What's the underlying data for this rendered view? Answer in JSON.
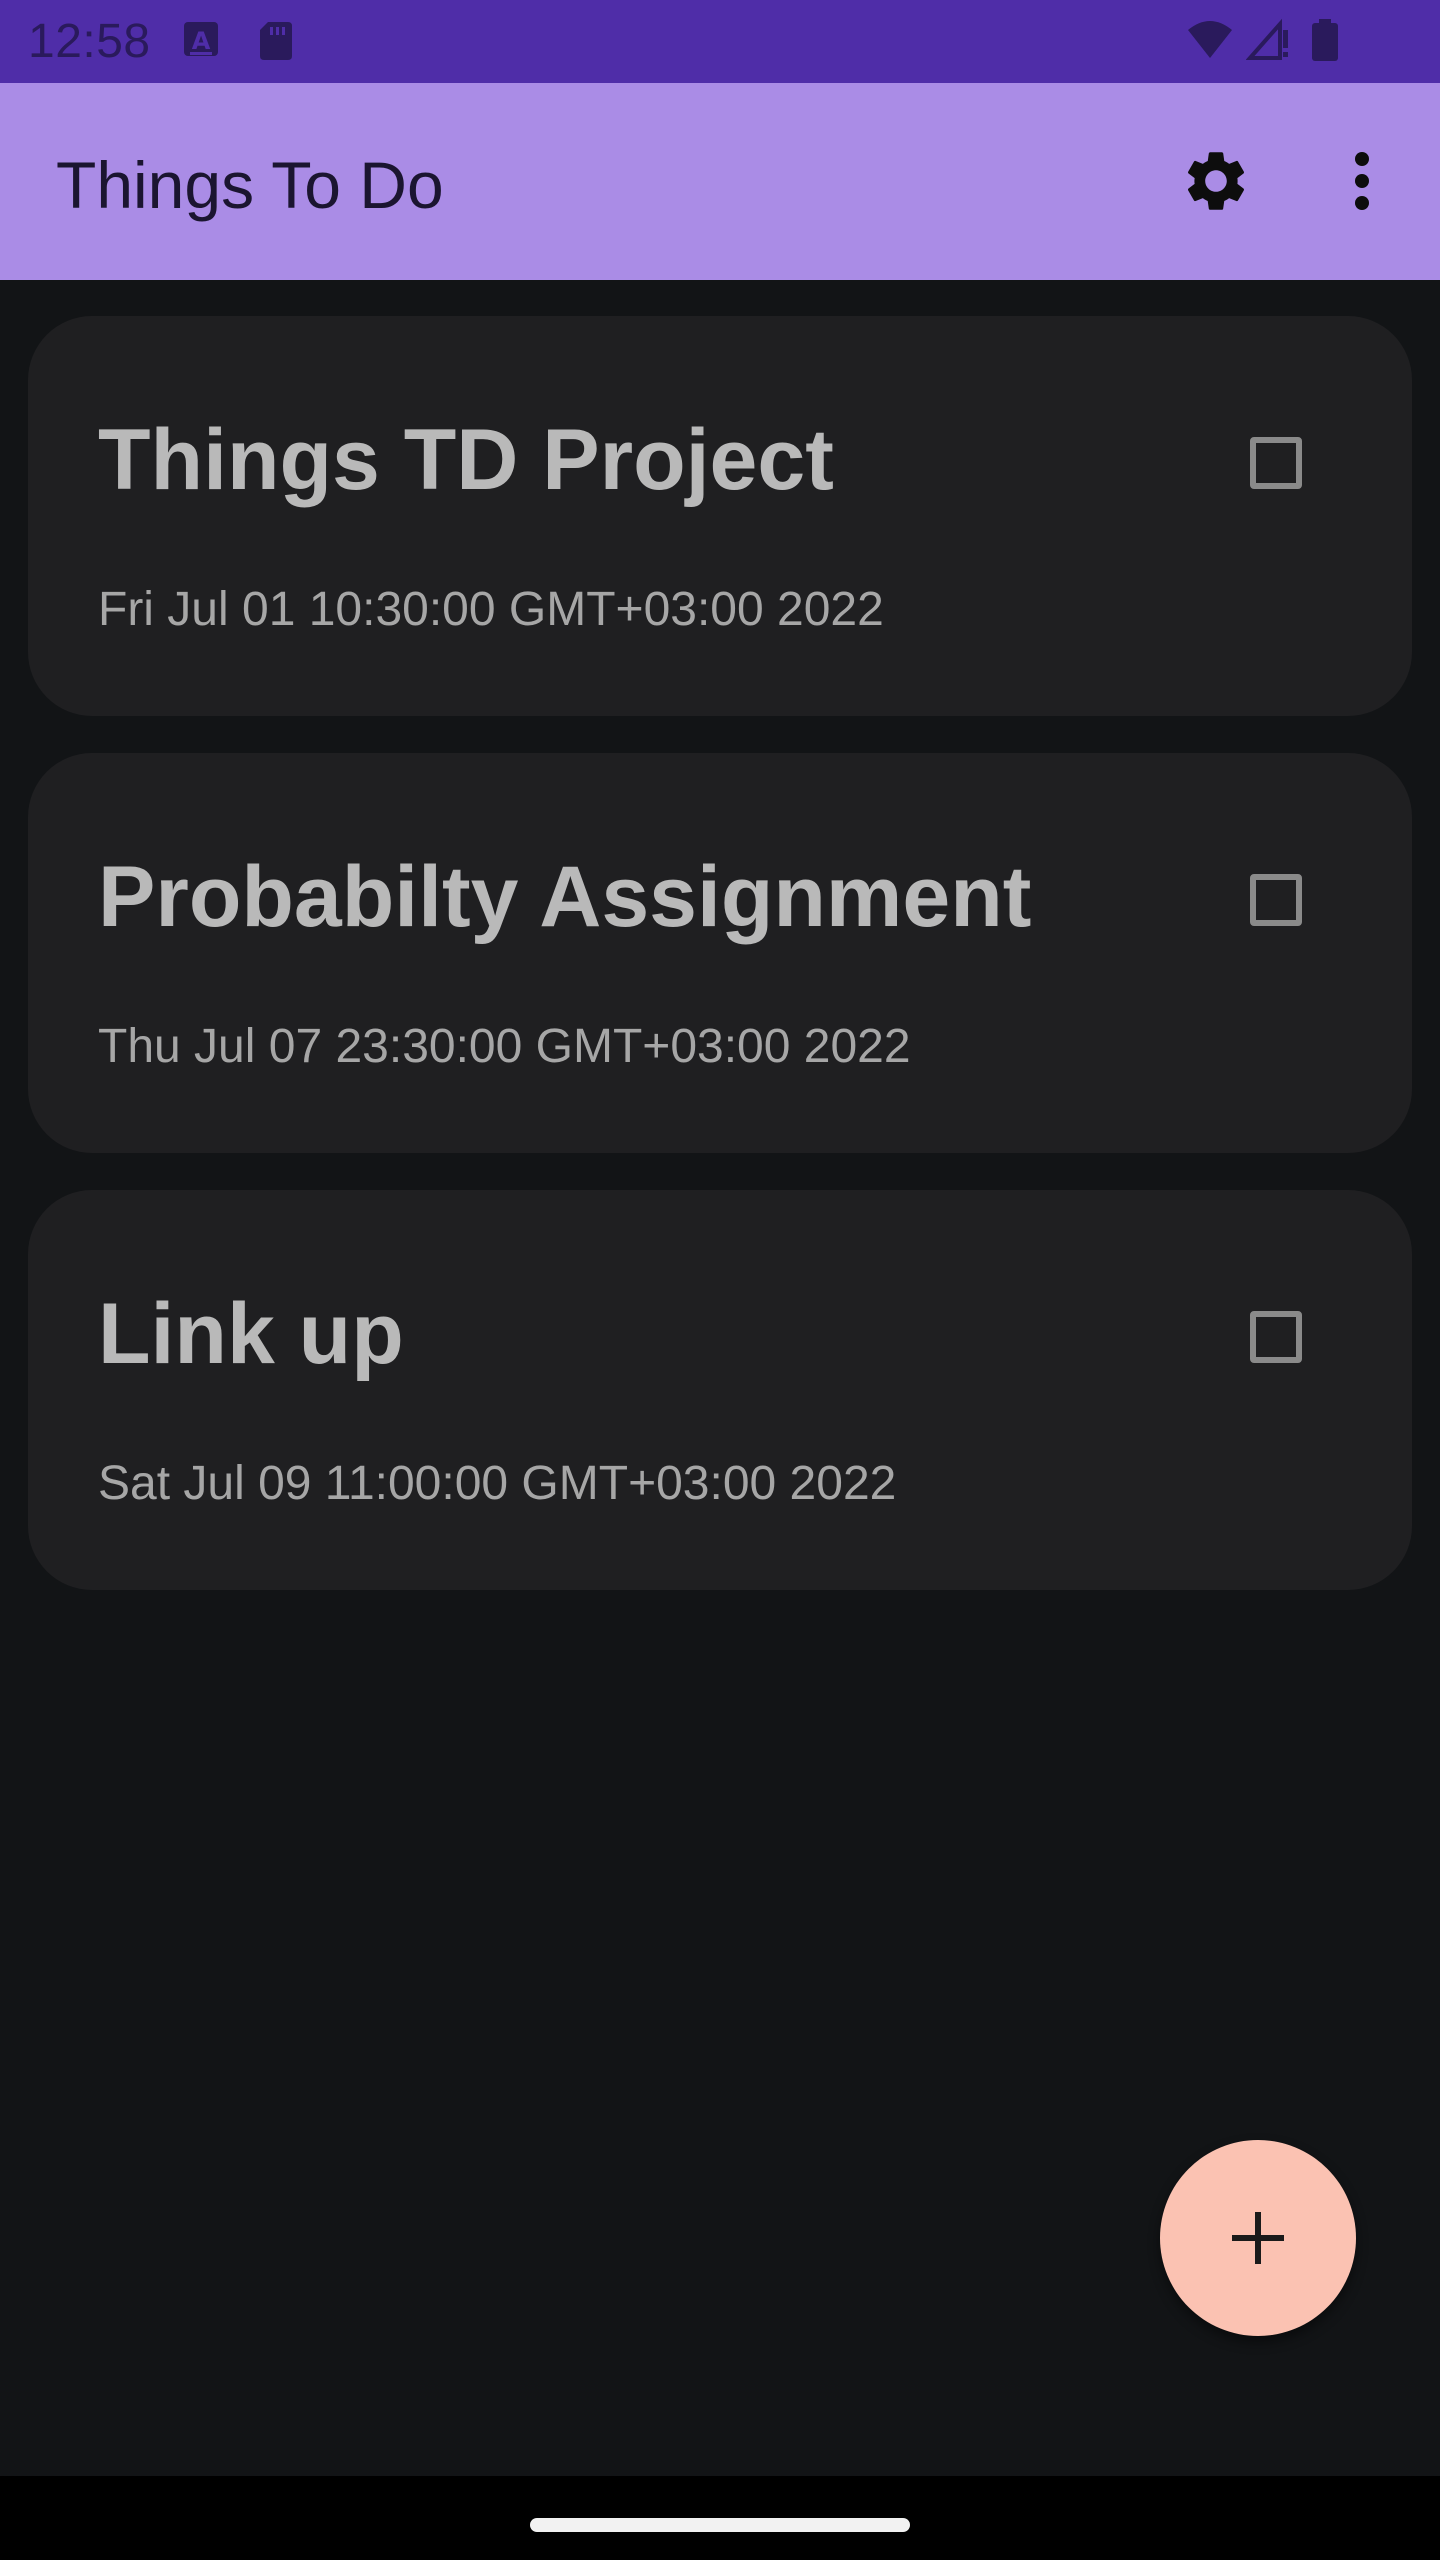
{
  "status_bar": {
    "time": "12:58",
    "icons": [
      "keyboard-a-icon",
      "sd-card-icon",
      "wifi-icon",
      "cellular-no-signal-icon",
      "battery-icon"
    ]
  },
  "app_bar": {
    "title": "Things To Do",
    "actions": [
      "settings-gear-icon",
      "more-vert-icon"
    ]
  },
  "tasks": [
    {
      "title": "Things TD Project",
      "date": "Fri Jul 01 10:30:00 GMT+03:00 2022",
      "checked": false
    },
    {
      "title": "Probabilty Assignment",
      "date": "Thu Jul 07 23:30:00 GMT+03:00 2022",
      "checked": false
    },
    {
      "title": "Link up",
      "date": "Sat Jul 09 11:00:00 GMT+03:00 2022",
      "checked": false
    }
  ],
  "fab": {
    "icon": "plus-icon"
  },
  "colors": {
    "status_bar": "#4f2da8",
    "app_bar": "#aa8ce6",
    "background": "#121416",
    "card": "#1f1f21",
    "fab": "#fbc2b2"
  }
}
